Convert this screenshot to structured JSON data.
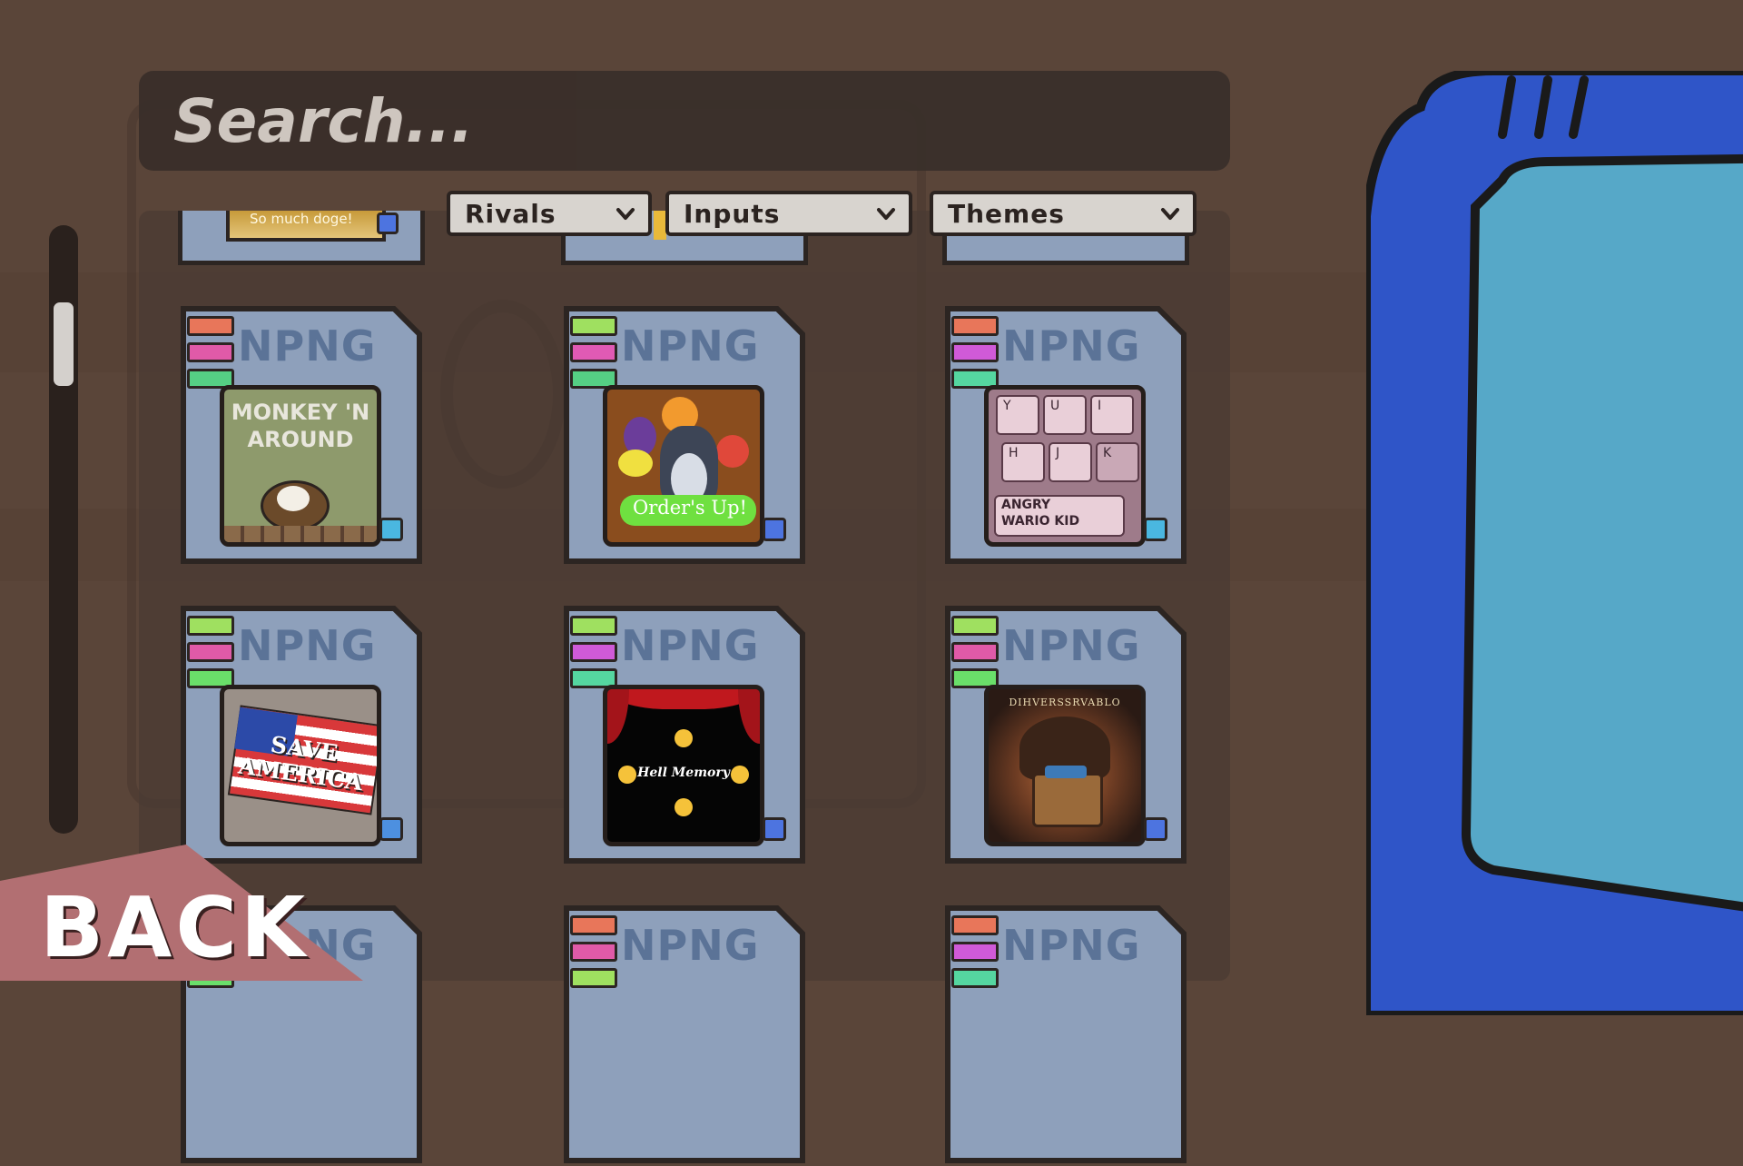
{
  "search": {
    "placeholder": "Search..."
  },
  "filters": [
    {
      "label": "Rivals"
    },
    {
      "label": "Inputs"
    },
    {
      "label": "Themes"
    }
  ],
  "partial_top_card": {
    "thumb_text": "So much doge!"
  },
  "cards": [
    {
      "brand": "NPNG",
      "title": "MONKEY 'N AROUND",
      "tags": [
        "#e8765a",
        "#e05aa8",
        "#55cf84"
      ],
      "badge": "#4ab7e0"
    },
    {
      "brand": "NPNG",
      "title": "Order's Up!",
      "tags": [
        "#9fe060",
        "#e05ab4",
        "#55cf84"
      ],
      "badge": "#4d74e0"
    },
    {
      "brand": "NPNG",
      "title": "ANGRY WARIO KID",
      "keys": [
        "Y",
        "U",
        "I",
        "H",
        "J",
        "K"
      ],
      "tags": [
        "#e8765a",
        "#d05ad8",
        "#55d6a0"
      ],
      "badge": "#4ab7e0"
    },
    {
      "brand": "NPNG",
      "title": "SAVE AMERICA",
      "tags": [
        "#9fe060",
        "#e05aa8",
        "#6adf6a"
      ],
      "badge": "#4d90e0"
    },
    {
      "brand": "NPNG",
      "title": "Hell Memory",
      "tags": [
        "#9fe060",
        "#d05ad8",
        "#55d6a0"
      ],
      "badge": "#4d74e0"
    },
    {
      "brand": "NPNG",
      "title": "DIHVERSSRVABLO",
      "tags": [
        "#9fe060",
        "#e05aa8",
        "#6adf6a"
      ],
      "badge": "#4d74e0"
    },
    {
      "brand": "NPNG",
      "tags": [
        "#9fe060",
        "#e05aa8",
        "#6adf6a"
      ]
    },
    {
      "brand": "NPNG",
      "tags": [
        "#e8765a",
        "#e05aa8",
        "#9fe060"
      ]
    },
    {
      "brand": "NPNG",
      "tags": [
        "#e8765a",
        "#d05ad8",
        "#55d6a0"
      ]
    }
  ],
  "back": {
    "label": "BACK"
  }
}
